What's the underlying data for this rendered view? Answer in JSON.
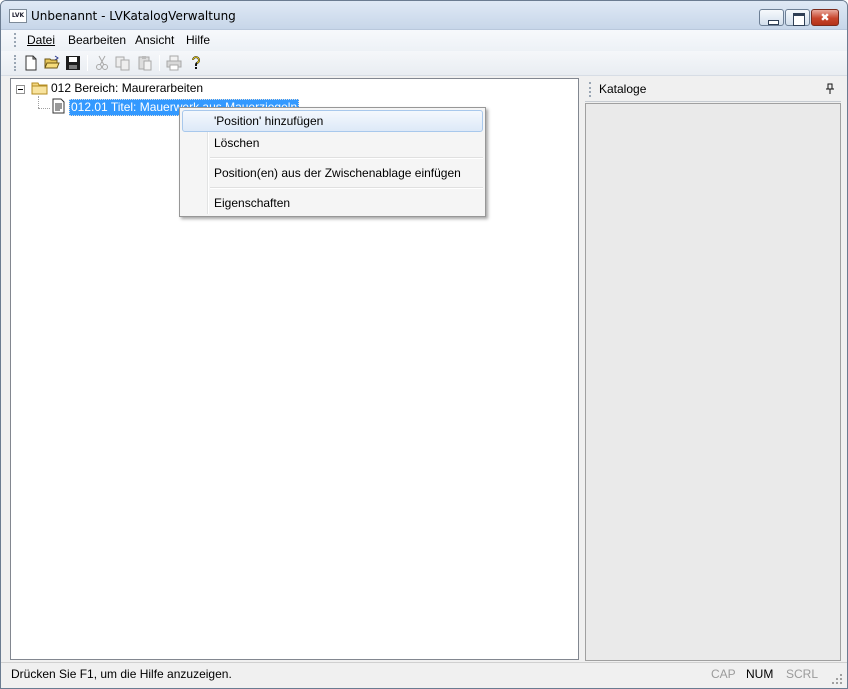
{
  "window": {
    "title": "Unbenannt - LVKatalogVerwaltung",
    "app_icon_text": "LVK"
  },
  "menu": {
    "items": [
      {
        "label": "Datei"
      },
      {
        "label": "Bearbeiten"
      },
      {
        "label": "Ansicht"
      },
      {
        "label": "Hilfe"
      }
    ]
  },
  "toolbar": {
    "buttons": [
      {
        "icon": "new-document-icon",
        "enabled": true
      },
      {
        "icon": "open-folder-icon",
        "enabled": true
      },
      {
        "icon": "save-disk-icon",
        "enabled": true
      },
      {
        "icon": "cut-scissors-icon",
        "enabled": false
      },
      {
        "icon": "copy-icon",
        "enabled": false
      },
      {
        "icon": "paste-icon",
        "enabled": false
      },
      {
        "icon": "print-icon",
        "enabled": false
      },
      {
        "icon": "help-question-icon",
        "enabled": true
      }
    ]
  },
  "tree": {
    "nodes": [
      {
        "label": "012 Bereich: Maurerarbeiten",
        "icon": "folder-icon",
        "expanded": true
      },
      {
        "label": "012.01 Titel: Mauerwerk aus Mauerziegeln",
        "icon": "document-icon",
        "selected": true
      }
    ]
  },
  "context_menu": {
    "items": [
      {
        "label": "'Position' hinzufügen",
        "highlighted": true
      },
      {
        "label": "Löschen"
      },
      {
        "label": "Position(en) aus der Zwischenablage einfügen"
      },
      {
        "label": "Eigenschaften"
      }
    ]
  },
  "dock": {
    "title": "Kataloge"
  },
  "statusbar": {
    "text": "Drücken Sie F1, um die Hilfe anzuzeigen.",
    "indicators": [
      {
        "label": "CAP",
        "active": false
      },
      {
        "label": "NUM",
        "active": true
      },
      {
        "label": "SCRL",
        "active": false
      }
    ]
  },
  "colors": {
    "selection": "#3399ff",
    "menu_highlight_border": "#a8c8ec"
  }
}
